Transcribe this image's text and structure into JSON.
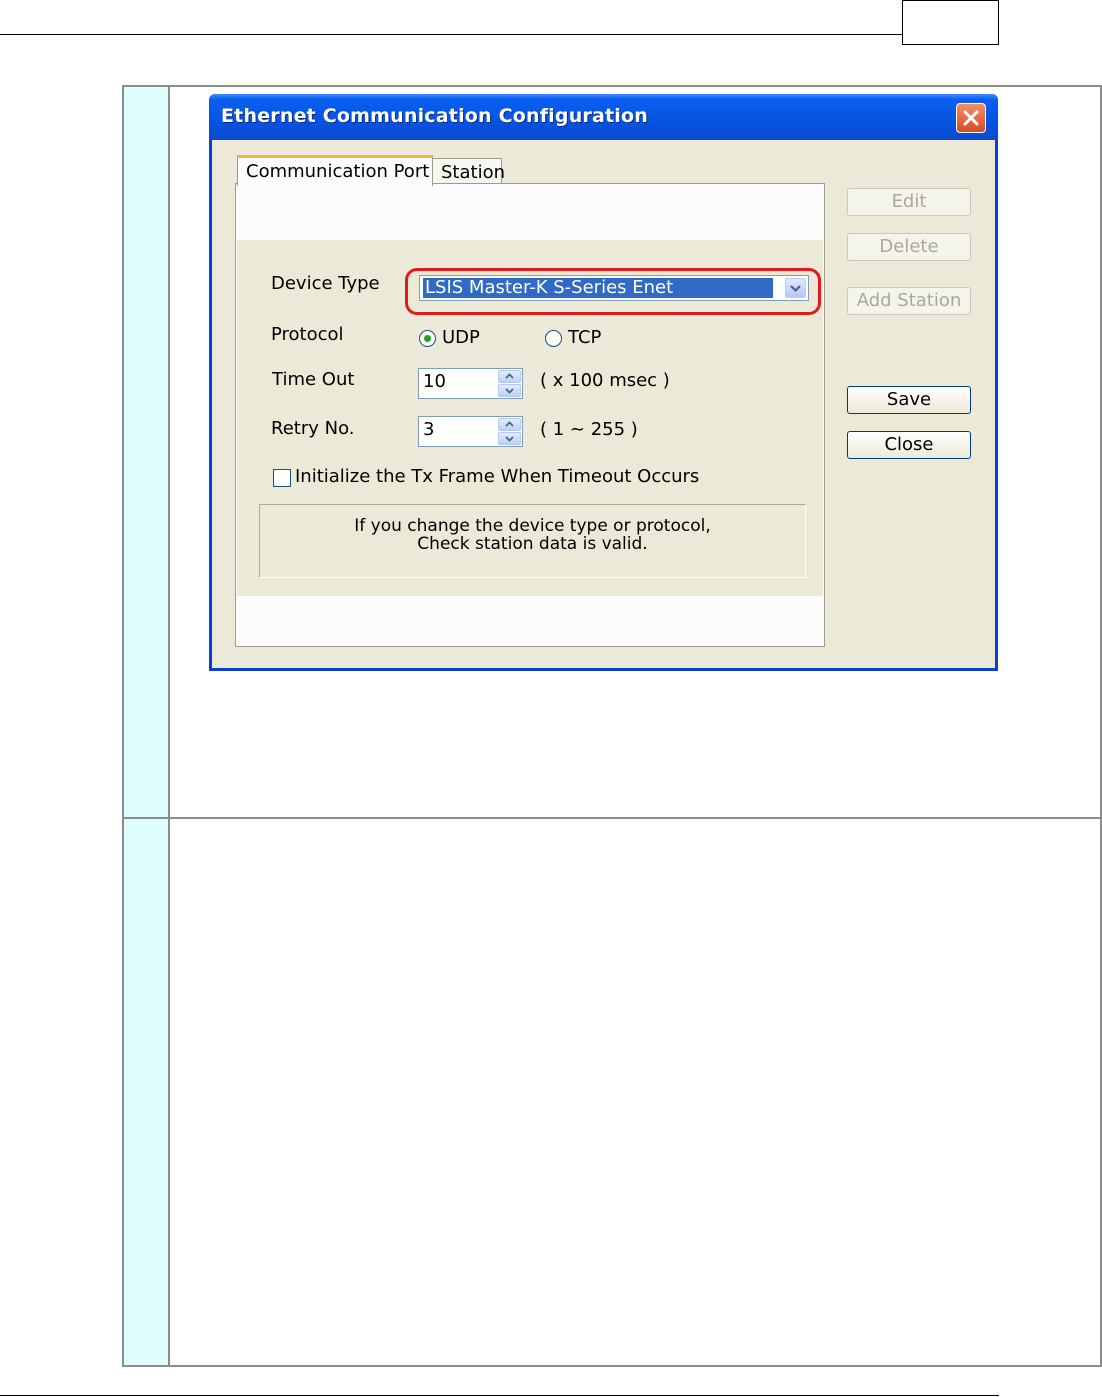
{
  "dialog": {
    "title": "Ethernet Communication Configuration",
    "tabs": [
      {
        "label": "Communication Port",
        "active": true
      },
      {
        "label": "Station",
        "active": false
      }
    ],
    "form": {
      "device_type_label": "Device Type",
      "device_type_value": "LSIS Master-K S-Series Enet",
      "protocol_label": "Protocol",
      "protocol_options": [
        {
          "label": "UDP",
          "selected": true
        },
        {
          "label": "TCP",
          "selected": false
        }
      ],
      "timeout_label": "Time Out",
      "timeout_value": "10",
      "timeout_unit": "( x 100 msec )",
      "retry_label": "Retry No.",
      "retry_value": "3",
      "retry_range": "( 1 ~ 255 )",
      "init_checkbox_label": "Initialize the Tx Frame When Timeout  Occurs",
      "init_checkbox_checked": false,
      "info_line1": "If you change the device type or protocol,",
      "info_line2": "Check station data is valid."
    },
    "buttons": {
      "edit": "Edit",
      "delete": "Delete",
      "add_station": "Add Station",
      "save": "Save",
      "close": "Close"
    }
  },
  "colors": {
    "highlight_ring": "#e31a1a",
    "title_bar": "#0753e0",
    "table_cell_accent": "#dfffff"
  }
}
